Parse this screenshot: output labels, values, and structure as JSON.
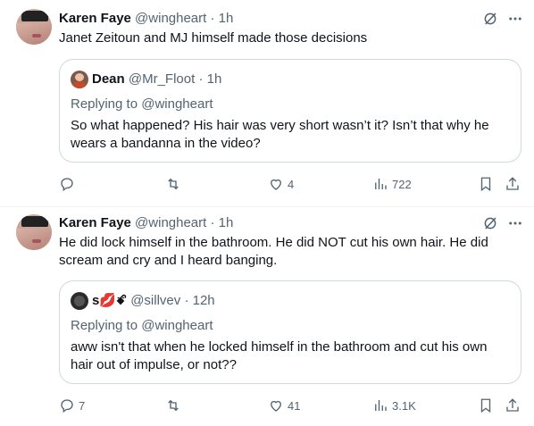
{
  "tweets": [
    {
      "author_name": "Karen Faye",
      "author_handle": "@wingheart",
      "separator": "·",
      "time": "1h",
      "text": "Janet Zeitoun and MJ himself made those decisions",
      "quote": {
        "author_name": "Dean",
        "author_handle": "@Mr_Floot",
        "separator": "·",
        "time": "1h",
        "replying_prefix": "Replying to ",
        "replying_to": "@wingheart",
        "text": "So what happened? His hair was very short wasn’t it? Isn’t that why he wears a bandanna in the video?"
      },
      "actions": {
        "replies": "",
        "retweets": "",
        "likes": "4",
        "views": "722"
      }
    },
    {
      "author_name": "Karen Faye",
      "author_handle": "@wingheart",
      "separator": "·",
      "time": "1h",
      "text": "He did lock himself in the bathroom. He did NOT cut his own hair. He did scream and cry and I heard banging.",
      "quote": {
        "author_name": "s💋ꗄ",
        "author_handle": "@sillvev",
        "separator": "·",
        "time": "12h",
        "replying_prefix": "Replying to ",
        "replying_to": "@wingheart",
        "text": "aww isn't that when he locked himself in the bathroom and cut his own hair out of impulse, or not??"
      },
      "actions": {
        "replies": "7",
        "retweets": "",
        "likes": "41",
        "views": "3.1K"
      }
    }
  ],
  "icons": {
    "grok": "grok-icon",
    "more": "more-icon",
    "reply": "reply-icon",
    "retweet": "retweet-icon",
    "like": "heart-icon",
    "views": "views-icon",
    "bookmark": "bookmark-icon",
    "share": "share-icon"
  },
  "colors": {
    "text": "#0f1419",
    "secondary": "#536471",
    "border": "#cfd9de",
    "divider": "#eff3f4"
  }
}
